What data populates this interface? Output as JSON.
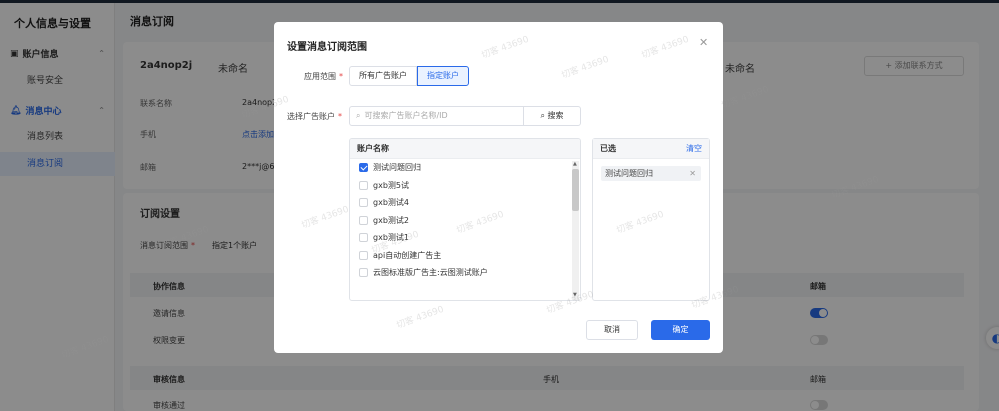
{
  "sidebar": {
    "title": "个人信息与设置",
    "group_account": "账户信息",
    "item_security": "账号安全",
    "group_message": "消息中心",
    "item_list": "消息列表",
    "item_subscribe": "消息订阅"
  },
  "main": {
    "title": "消息订阅",
    "account_name": "2a4nop2j",
    "account_note": "未命名",
    "account_note2": "未命名",
    "add_contact": "+ 添加联系方式",
    "contact_label": "联系名称",
    "contact_value": "2a4nop2j",
    "phone_label": "手机",
    "phone_value": "点击添加",
    "email_label": "邮箱",
    "email_value": "2***j@6",
    "settings_title": "订阅设置",
    "scope_label": "消息订阅范围",
    "scope_value": "指定1个账户",
    "sec1_title": "协作信息",
    "sec1_col_email": "邮箱",
    "row_invite": "邀请信息",
    "row_permission": "权限变更",
    "sec2_title": "审核信息",
    "sec2_col_phone": "手机",
    "sec2_col_email": "邮箱",
    "row_audit_pass": "审核通过"
  },
  "modal": {
    "title": "设置消息订阅范围",
    "scope_label": "应用范围",
    "scope_all": "所有广告账户",
    "scope_specific": "指定账户",
    "select_label": "选择广告账户",
    "search_placeholder": "可搜索广告账户名称/ID",
    "search_button": "搜索",
    "list_header": "账户名称",
    "accounts": [
      {
        "name": "测试问题回归",
        "checked": true
      },
      {
        "name": "gxb测5试",
        "checked": false
      },
      {
        "name": "gxb测试4",
        "checked": false
      },
      {
        "name": "gxb测试2",
        "checked": false
      },
      {
        "name": "gxb测试1",
        "checked": false
      },
      {
        "name": "api自动创建广告主",
        "checked": false
      },
      {
        "name": "云图标准版广告主:云图测试账户",
        "checked": false
      }
    ],
    "selected_header": "已选",
    "clear_label": "清空",
    "selected_tag": "测试问题回归",
    "cancel": "取消",
    "confirm": "确定"
  },
  "watermark": "切客 43690",
  "colors": {
    "accent": "#2a6ae9",
    "overlay": "rgba(0,0,0,0.45)"
  }
}
